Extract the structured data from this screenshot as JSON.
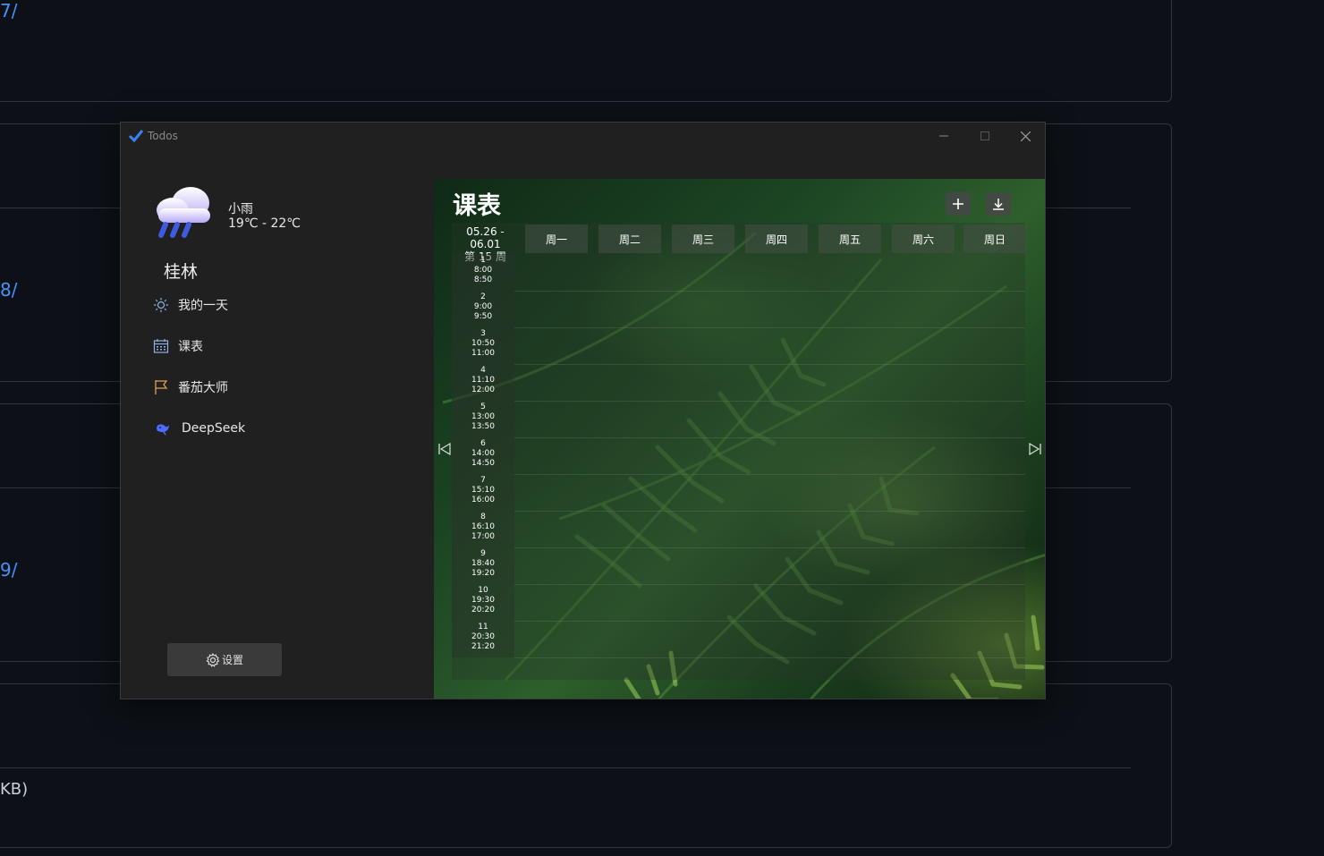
{
  "background_page": {
    "links": [
      "7/",
      "8/",
      "9/"
    ],
    "file_size_text": "KB)"
  },
  "window": {
    "title": "Todos",
    "accent_color": "#3b82f6"
  },
  "sidebar": {
    "weather": {
      "description": "小雨",
      "temperature": "19℃ - 22℃",
      "icon": "rain-cloud-icon"
    },
    "city": "桂林",
    "nav_items": [
      {
        "label": "我的一天",
        "icon": "sun-icon"
      },
      {
        "label": "课表",
        "icon": "calendar-icon"
      },
      {
        "label": "番茄大师",
        "icon": "flag-icon"
      },
      {
        "label": "DeepSeek",
        "icon": "deepseek-whale-icon"
      }
    ],
    "settings_label": "设置"
  },
  "schedule": {
    "title": "课表",
    "week_range": "05.26 - 06.01",
    "week_number": "第 15 周",
    "days": [
      "周一",
      "周二",
      "周三",
      "周四",
      "周五",
      "周六",
      "周日"
    ],
    "periods": [
      {
        "no": "1",
        "start": "8:00",
        "end": "8:50"
      },
      {
        "no": "2",
        "start": "9:00",
        "end": "9:50"
      },
      {
        "no": "3",
        "start": "10:50",
        "end": "11:00"
      },
      {
        "no": "4",
        "start": "11:10",
        "end": "12:00"
      },
      {
        "no": "5",
        "start": "13:00",
        "end": "13:50"
      },
      {
        "no": "6",
        "start": "14:00",
        "end": "14:50"
      },
      {
        "no": "7",
        "start": "15:10",
        "end": "16:00"
      },
      {
        "no": "8",
        "start": "16:10",
        "end": "17:00"
      },
      {
        "no": "9",
        "start": "18:40",
        "end": "19:20"
      },
      {
        "no": "10",
        "start": "19:30",
        "end": "20:20"
      },
      {
        "no": "11",
        "start": "20:30",
        "end": "21:20"
      }
    ]
  }
}
